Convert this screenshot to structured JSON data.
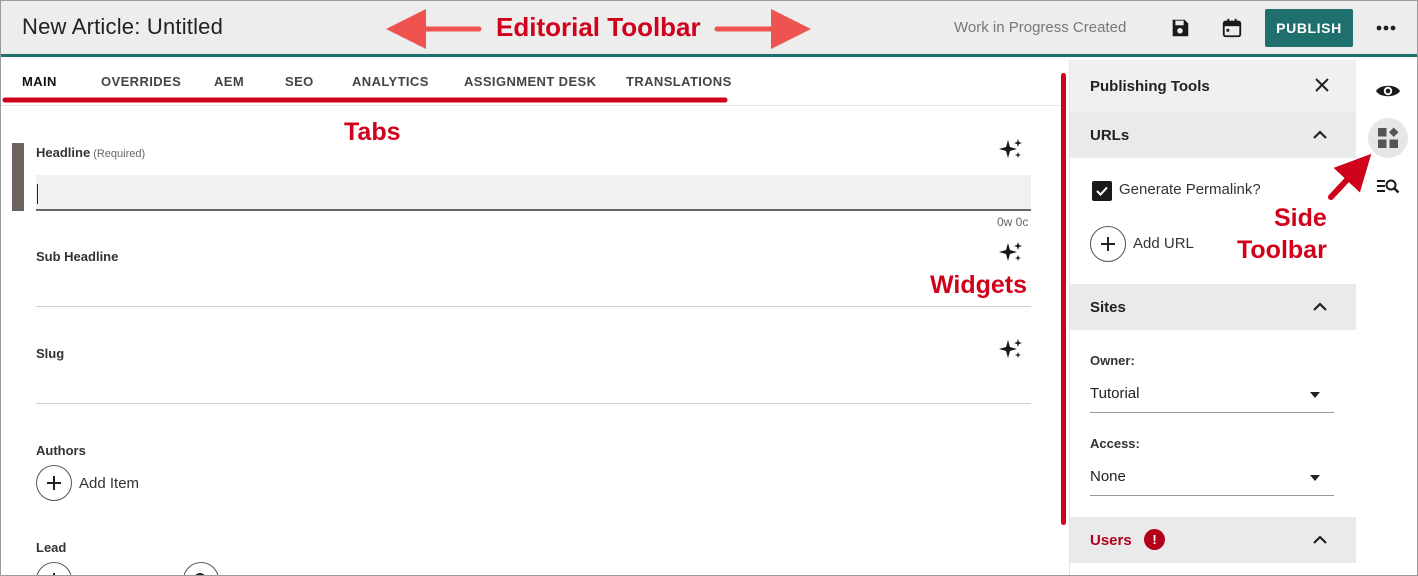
{
  "header": {
    "title": "New Article: Untitled",
    "status": "Work in Progress Created",
    "publish_label": "PUBLISH",
    "icons": [
      "save-icon",
      "calendar-icon",
      "more-icon"
    ]
  },
  "tabs": [
    {
      "label": "MAIN",
      "active": true
    },
    {
      "label": "OVERRIDES"
    },
    {
      "label": "AEM"
    },
    {
      "label": "SEO"
    },
    {
      "label": "ANALYTICS"
    },
    {
      "label": "ASSIGNMENT DESK"
    },
    {
      "label": "TRANSLATIONS"
    }
  ],
  "main": {
    "headline_label": "Headline",
    "headline_required": "(Required)",
    "headline_value": "",
    "counter": "0w 0c",
    "subheadline_label": "Sub Headline",
    "slug_label": "Slug",
    "authors_label": "Authors",
    "add_item_label": "Add Item",
    "lead_label": "Lead"
  },
  "panel": {
    "title": "Publishing Tools",
    "urls_title": "URLs",
    "generate_permalink": "Generate Permalink?",
    "generate_permalink_checked": true,
    "add_url_label": "Add URL",
    "sites_title": "Sites",
    "owner_label": "Owner:",
    "owner_value": "Tutorial",
    "access_label": "Access:",
    "access_value": "None",
    "users_title": "Users",
    "users_badge": "!"
  },
  "side_toolbar": {
    "icons": [
      "eye-icon",
      "widgets-icon",
      "search-list-icon"
    ]
  },
  "annotations": {
    "editorial_toolbar": "Editorial Toolbar",
    "tabs": "Tabs",
    "widgets": "Widgets",
    "side_toolbar_line1": "Side",
    "side_toolbar_line2": "Toolbar"
  },
  "colors": {
    "accent": "#1f6f6c",
    "annotation": "#d0021b",
    "error": "#b3001b"
  }
}
